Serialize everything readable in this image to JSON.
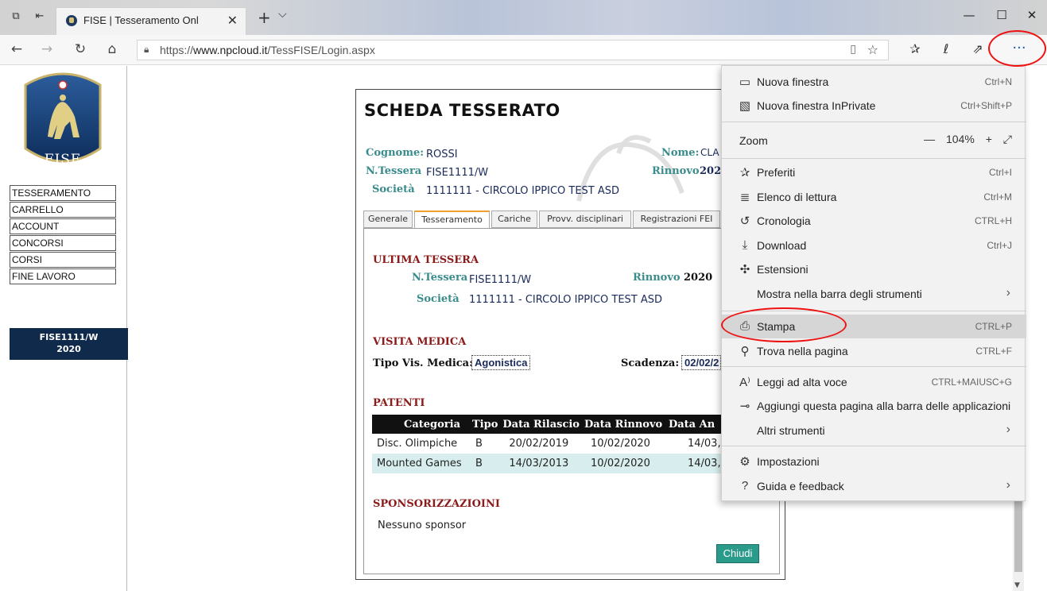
{
  "browser": {
    "tab_title": "FISE | Tesseramento Onl",
    "url_prefix": "https://",
    "url_domain": "www.npcloud.it",
    "url_path": "/TessFISE/Login.aspx"
  },
  "sidebar": {
    "logo_text": "FISE",
    "items": [
      "TESSERAMENTO",
      "CARRELLO",
      "ACCOUNT",
      "CONCORSI",
      "CORSI",
      "FINE LAVORO"
    ],
    "user_code": "FISE1111/W",
    "user_year": "2020"
  },
  "card": {
    "title": "SCHEDA TESSERATO",
    "cognome_label": "Cognome:",
    "cognome": "ROSSI",
    "nome_label": "Nome:",
    "nome": "CLA",
    "tessera_label": "N.Tessera",
    "tessera": "FISE1111/W",
    "rinnovo_label": "Rinnovo",
    "rinnovo": "202",
    "societa_label": "Società",
    "societa": "1111111 - CIRCOLO IPPICO TEST ASD",
    "tabs": [
      "Generale",
      "Tesseramento",
      "Cariche",
      "Provv. disciplinari",
      "Registrazioni FEI"
    ],
    "ultima": {
      "heading": "ULTIMA TESSERA",
      "tessera_label": "N.Tessera",
      "tessera": "FISE1111/W",
      "rinnovo_label": "Rinnovo",
      "rinnovo": "2020",
      "societa_label": "Società",
      "societa": "1111111 - CIRCOLO IPPICO TEST ASD"
    },
    "visita": {
      "heading": "VISITA MEDICA",
      "tipo_label": "Tipo Vis. Medica:",
      "tipo": "Agonistica",
      "scadenza_label": "Scadenza:",
      "scadenza": "02/02/2"
    },
    "patenti": {
      "heading": "PATENTI",
      "columns": [
        "Categoria",
        "Tipo",
        "Data Rilascio",
        "Data Rinnovo",
        "Data An"
      ],
      "rows": [
        [
          "Disc. Olimpiche",
          "B",
          "20/02/2019",
          "10/02/2020",
          "14/03,"
        ],
        [
          "Mounted Games",
          "B",
          "14/03/2013",
          "10/02/2020",
          "14/03,"
        ]
      ]
    },
    "sponsor": {
      "heading": "SPONSORIZZAZIOINI",
      "text": "Nessuno sponsor"
    },
    "close_label": "Chiudi"
  },
  "menu": {
    "new_window": "Nuova finestra",
    "new_window_sc": "Ctrl+N",
    "new_private": "Nuova finestra InPrivate",
    "new_private_sc": "Ctrl+Shift+P",
    "zoom_label": "Zoom",
    "zoom_value": "104%",
    "favorites": "Preferiti",
    "favorites_sc": "Ctrl+I",
    "reading": "Elenco di lettura",
    "reading_sc": "Ctrl+M",
    "history": "Cronologia",
    "history_sc": "CTRL+H",
    "download": "Download",
    "download_sc": "Ctrl+J",
    "extensions": "Estensioni",
    "show_toolbar": "Mostra nella barra degli strumenti",
    "print": "Stampa",
    "print_sc": "CTRL+P",
    "find": "Trova nella pagina",
    "find_sc": "CTRL+F",
    "read_aloud": "Leggi ad alta voce",
    "read_aloud_sc": "CTRL+MAIUSC+G",
    "pin_taskbar": "Aggiungi questa pagina alla barra delle applicazioni",
    "more_tools": "Altri strumenti",
    "settings": "Impostazioni",
    "help": "Guida e feedback"
  },
  "colors": {
    "accent_red": "#8b1a1a",
    "label_teal": "#3b8c8c",
    "navy": "#0f2a4a",
    "annotation": "#ee1111"
  }
}
